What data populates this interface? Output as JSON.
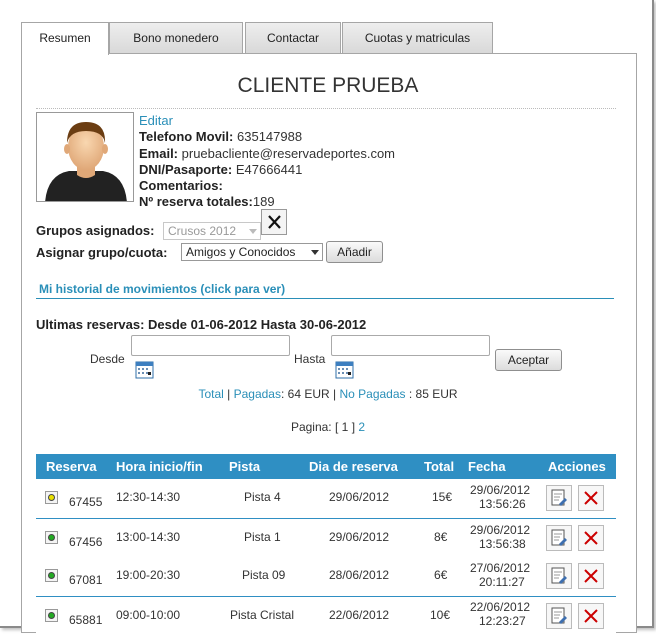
{
  "tabs": [
    {
      "label": "Resumen",
      "active": true
    },
    {
      "label": "Bono monedero",
      "active": false
    },
    {
      "label": "Contactar",
      "active": false
    },
    {
      "label": "Cuotas y matriculas",
      "active": false
    }
  ],
  "client": {
    "name": "CLIENTE PRUEBA",
    "edit_label": "Editar",
    "phone_label": "Telefono Movil:",
    "phone": "635147988",
    "email_label": "Email:",
    "email": "pruebacliente@reservadeportes.com",
    "dni_label": "DNI/Pasaporte:",
    "dni": "E47666441",
    "comments_label": "Comentarios:",
    "comments": "",
    "total_label": "Nº reserva totales:",
    "total": "189"
  },
  "groups": {
    "assigned_label": "Grupos asignados:",
    "assigned_value": "Crusos 2012",
    "assign_label": "Asignar grupo/cuota:",
    "assign_value": "Amigos y Conocidos",
    "add_button": "Añadir"
  },
  "history_link": "Mi historial de movimientos (click para ver)",
  "reservations": {
    "heading": "Ultimas reservas: Desde 01-06-2012 Hasta 30-06-2012",
    "desde_label": "Desde",
    "hasta_label": "Hasta",
    "desde_value": "",
    "hasta_value": "",
    "accept_button": "Aceptar",
    "totals": {
      "total_link": "Total",
      "pagadas_link": "Pagadas",
      "pagadas_value": ": 64 EUR",
      "no_pagadas_link": "No Pagadas",
      "no_pagadas_value": ": 85 EUR"
    },
    "pager": {
      "label": "Pagina: [",
      "current": "1",
      "close": "]",
      "next": "2"
    },
    "columns": [
      "Reserva",
      "Hora inicio/fin",
      "Pista",
      "Dia de reserva",
      "Total",
      "Fecha",
      "Acciones"
    ],
    "rows": [
      {
        "status": "yellow",
        "id": "67455",
        "hours": "12:30-14:30",
        "court": "Pista 4",
        "day": "29/06/2012",
        "total": "15€",
        "date": "29/06/2012",
        "time": "13:56:26"
      },
      {
        "status": "green",
        "id": "67456",
        "hours": "13:00-14:30",
        "court": "Pista 1",
        "day": "29/06/2012",
        "total": "8€",
        "date": "29/06/2012",
        "time": "13:56:38"
      },
      {
        "status": "green",
        "id": "67081",
        "hours": "19:00-20:30",
        "court": "Pista 09",
        "day": "28/06/2012",
        "total": "6€",
        "date": "27/06/2012",
        "time": "20:11:27"
      },
      {
        "status": "green",
        "id": "65881",
        "hours": "09:00-10:00",
        "court": "Pista Cristal",
        "day": "22/06/2012",
        "total": "10€",
        "date": "22/06/2012",
        "time": "12:23:27"
      }
    ]
  },
  "colors": {
    "accent": "#2f8fc3",
    "link": "#2a8fb8",
    "status_green": "#22aa22",
    "status_yellow": "#e8e000",
    "delete_red": "#cc0000"
  }
}
